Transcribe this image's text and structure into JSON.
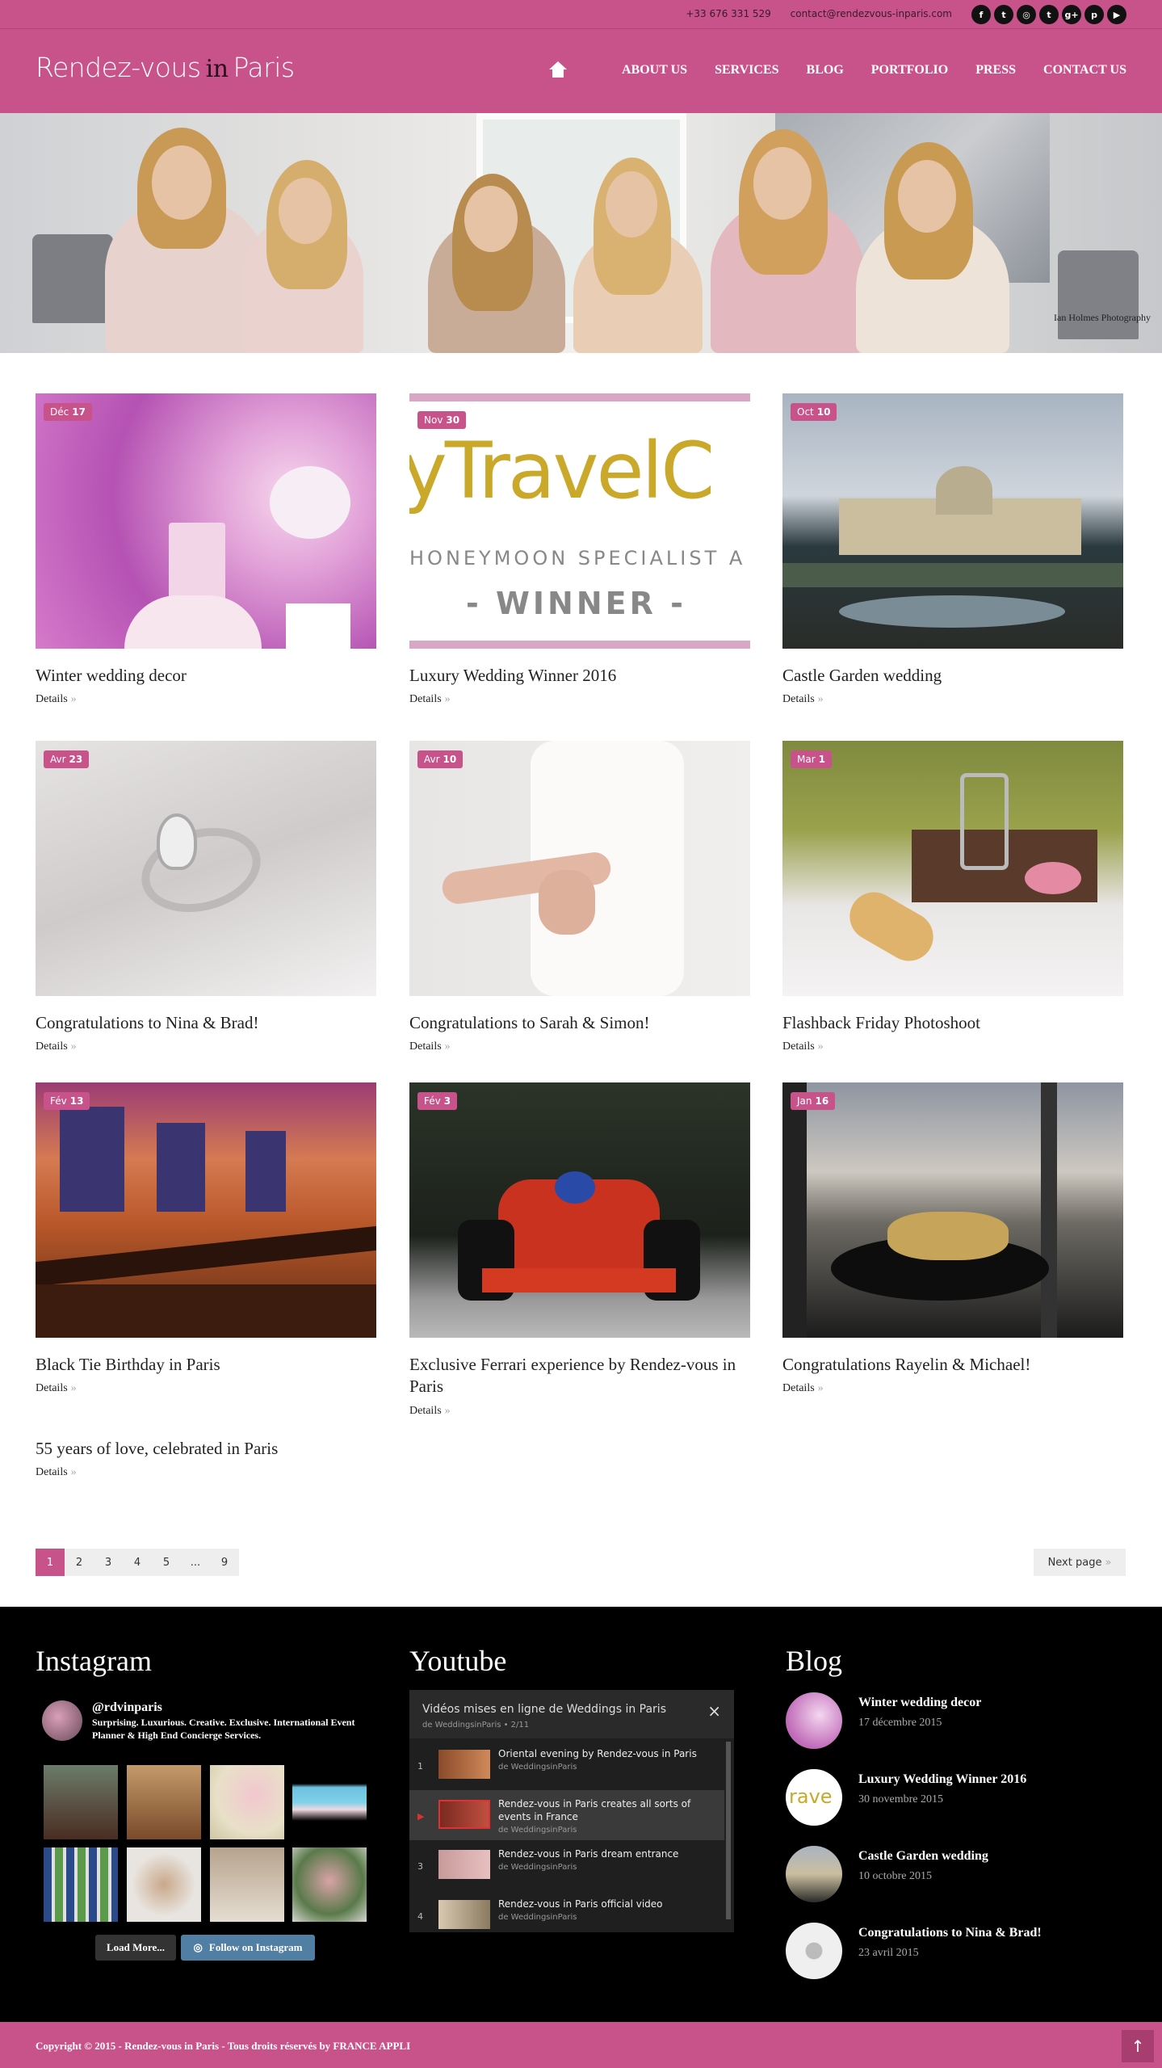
{
  "topbar": {
    "phone": "+33 676 331 529",
    "email": "contact@rendezvous-inparis.com",
    "social": [
      {
        "icon": "facebook-icon",
        "glyph": "f"
      },
      {
        "icon": "twitter-icon",
        "glyph": "t"
      },
      {
        "icon": "instagram-icon",
        "glyph": "◎"
      },
      {
        "icon": "tumblr-icon",
        "glyph": "t"
      },
      {
        "icon": "googleplus-icon",
        "glyph": "g+"
      },
      {
        "icon": "pinterest-icon",
        "glyph": "p"
      },
      {
        "icon": "youtube-icon",
        "glyph": "▶"
      }
    ]
  },
  "logo": {
    "part1": "Rendez-vous",
    "in": "in",
    "part2": "Paris"
  },
  "nav": {
    "home_icon": "home-icon",
    "items": [
      "ABOUT US",
      "SERVICES",
      "BLOG",
      "PORTFOLIO",
      "PRESS",
      "CONTACT US"
    ]
  },
  "hero": {
    "credit": "Ian Holmes Photography"
  },
  "posts": [
    {
      "month": "Déc",
      "day": "17",
      "title": "Winter wedding decor",
      "details": "Details"
    },
    {
      "month": "Nov",
      "day": "30",
      "title": "Luxury Wedding Winner 2016",
      "details": "Details",
      "img_text": [
        "yTravelC",
        "HONEYMOON SPECIALIST A",
        "- WINNER -"
      ]
    },
    {
      "month": "Oct",
      "day": "10",
      "title": "Castle Garden wedding",
      "details": "Details"
    },
    {
      "month": "Avr",
      "day": "23",
      "title": "Congratulations to Nina & Brad!",
      "details": "Details"
    },
    {
      "month": "Avr",
      "day": "10",
      "title": "Congratulations to Sarah & Simon!",
      "details": "Details"
    },
    {
      "month": "Mar",
      "day": "1",
      "title": "Flashback Friday Photoshoot",
      "details": "Details"
    },
    {
      "month": "Fév",
      "day": "13",
      "title": "Black Tie Birthday in Paris",
      "details": "Details"
    },
    {
      "month": "Fév",
      "day": "3",
      "title": "Exclusive Ferrari experience by Rendez-vous in Paris",
      "details": "Details"
    },
    {
      "month": "Jan",
      "day": "16",
      "title": "Congratulations Rayelin & Michael!",
      "details": "Details"
    },
    {
      "title": "55 years of love, celebrated in Paris",
      "details": "Details"
    }
  ],
  "pagination": {
    "pages": [
      "1",
      "2",
      "3",
      "4",
      "5",
      "...",
      "9"
    ],
    "active": "1",
    "next": "Next page"
  },
  "footer": {
    "instagram": {
      "heading": "Instagram",
      "handle": "@rdvinparis",
      "bio": "Surprising. Luxurious. Creative. Exclusive. International Event Planner & High End Concierge Services.",
      "load_more": "Load More...",
      "follow": "Follow on Instagram"
    },
    "youtube": {
      "heading": "Youtube",
      "playlist_title": "Vidéos mises en ligne de Weddings in Paris",
      "playlist_sub": "de WeddingsinParis • 2/11",
      "videos": [
        {
          "num": "1",
          "title": "Oriental evening by Rendez-vous in Paris",
          "channel": "de WeddingsinParis"
        },
        {
          "num": "▶",
          "title": "Rendez-vous in Paris creates all sorts of events in France",
          "channel": "de WeddingsinParis"
        },
        {
          "num": "3",
          "title": "Rendez-vous in Paris dream entrance",
          "channel": "de WeddingsinParis"
        },
        {
          "num": "4",
          "title": "Rendez-vous in Paris official video",
          "channel": "de WeddingsinParis"
        }
      ]
    },
    "blog": {
      "heading": "Blog",
      "posts": [
        {
          "title": "Winter wedding decor",
          "date": "17 décembre 2015"
        },
        {
          "title": "Luxury Wedding Winner 2016",
          "date": "30 novembre 2015"
        },
        {
          "title": "Castle Garden wedding",
          "date": "10 octobre 2015"
        },
        {
          "title": "Congratulations to Nina & Brad!",
          "date": "23 avril 2015"
        }
      ]
    }
  },
  "copyright": "Copyright © 2015 - Rendez-vous in Paris - Tous droits réservés by FRANCE APPLI",
  "colors": {
    "brand": "#c8528a",
    "footer": "#000000"
  }
}
